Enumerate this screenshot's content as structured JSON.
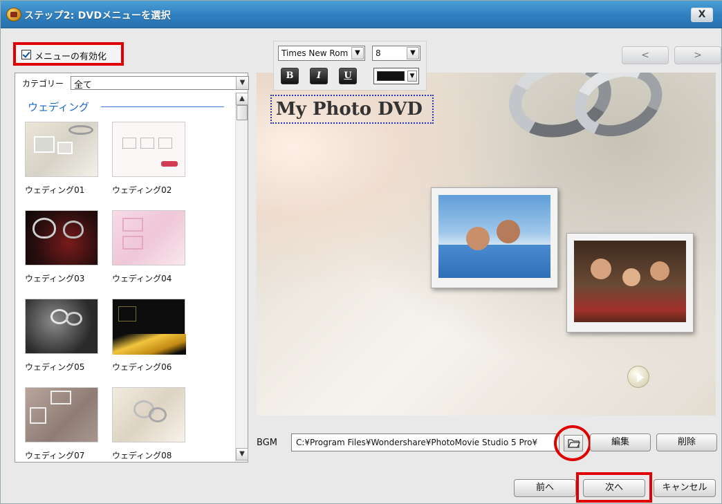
{
  "window": {
    "title": "ステップ2: DVDメニューを選択",
    "close_label": "X"
  },
  "enable_menu": {
    "label": "メニューの有効化",
    "checked": true
  },
  "navigation": {
    "prev_label": "<",
    "next_label": ">"
  },
  "category": {
    "label": "カテゴリー",
    "selected": "全て"
  },
  "templates": {
    "group": "ウェディング",
    "items": [
      "ウェディング01",
      "ウェディング02",
      "ウェディング03",
      "ウェディング04",
      "ウェディング05",
      "ウェディング06",
      "ウェディング07",
      "ウェディング08"
    ]
  },
  "text_toolbar": {
    "font": "Times New Rom",
    "size": "8",
    "bold_label": "B",
    "italic_label": "I",
    "underline_label": "U",
    "color": "#111111"
  },
  "preview": {
    "title_text": "My Photo DVD"
  },
  "bgm": {
    "label": "BGM",
    "path": "C:¥Program Files¥Wondershare¥PhotoMovie Studio 5 Pro¥",
    "edit_label": "編集",
    "delete_label": "削除"
  },
  "footer": {
    "back_label": "前へ",
    "next_label": "次へ",
    "cancel_label": "キャンセル"
  },
  "colors": {
    "titlebar": "#2f7fbf",
    "highlight": "#e00000",
    "group_heading": "#1a66c8"
  }
}
